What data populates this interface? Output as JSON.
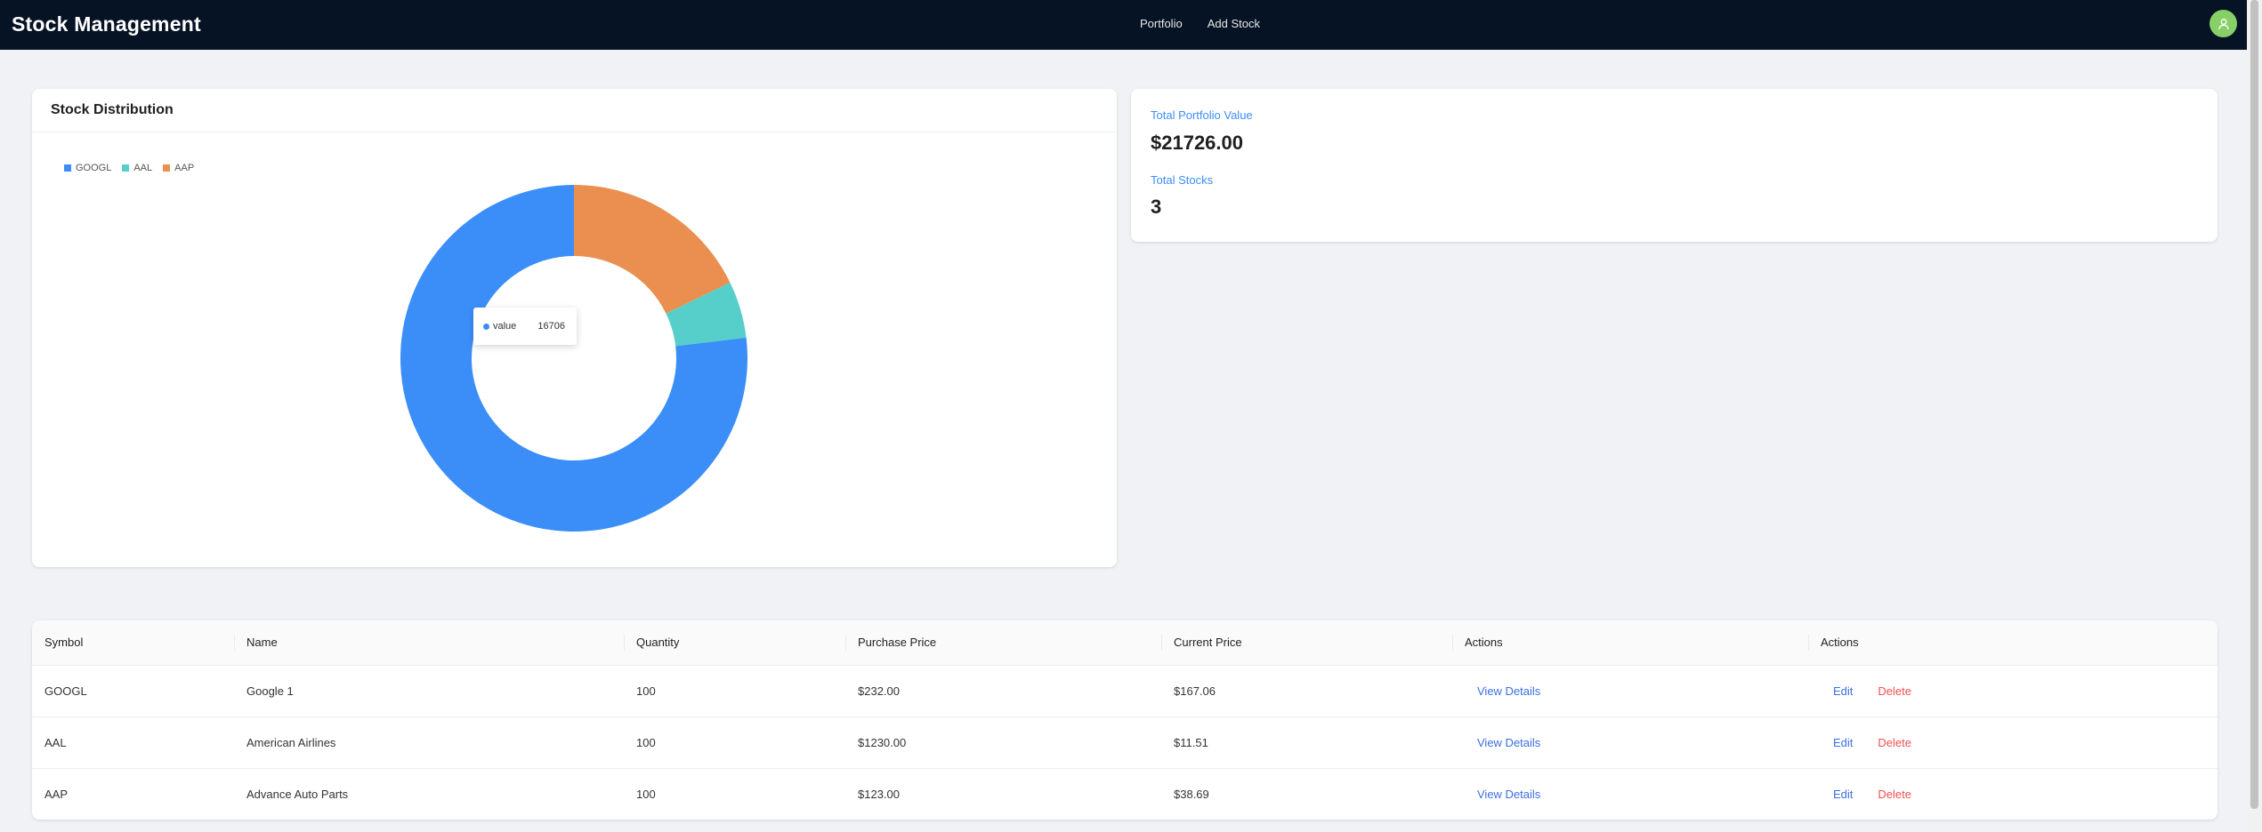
{
  "navbar": {
    "brand": "Stock Management",
    "links": [
      {
        "label": "Portfolio"
      },
      {
        "label": "Add Stock"
      }
    ]
  },
  "chart_card": {
    "title": "Stock Distribution"
  },
  "chart_data": {
    "type": "pie",
    "donut": true,
    "categories": [
      "GOOGL",
      "AAL",
      "AAP"
    ],
    "values": [
      16706,
      1151,
      3869
    ],
    "colors": [
      "#3b8ef8",
      "#56cfcb",
      "#ea8f4f"
    ],
    "legend_position": "top-left",
    "tooltip": {
      "label": "value",
      "value": "16706"
    }
  },
  "stats": {
    "total_value_label": "Total Portfolio Value",
    "total_value": "$21726.00",
    "total_stocks_label": "Total Stocks",
    "total_stocks": "3"
  },
  "table": {
    "columns": [
      "Symbol",
      "Name",
      "Quantity",
      "Purchase Price",
      "Current Price",
      "Actions",
      "Actions"
    ],
    "rows": [
      {
        "symbol": "GOOGL",
        "name": "Google 1",
        "quantity": "100",
        "purchase_price": "$232.00",
        "current_price": "$167.06",
        "view": "View Details",
        "edit": "Edit",
        "delete": "Delete"
      },
      {
        "symbol": "AAL",
        "name": "American Airlines",
        "quantity": "100",
        "purchase_price": "$1230.00",
        "current_price": "$11.51",
        "view": "View Details",
        "edit": "Edit",
        "delete": "Delete"
      },
      {
        "symbol": "AAP",
        "name": "Advance Auto Parts",
        "quantity": "100",
        "purchase_price": "$123.00",
        "current_price": "$38.69",
        "view": "View Details",
        "edit": "Edit",
        "delete": "Delete"
      }
    ]
  },
  "user": {
    "avatar_icon": "user-icon"
  }
}
